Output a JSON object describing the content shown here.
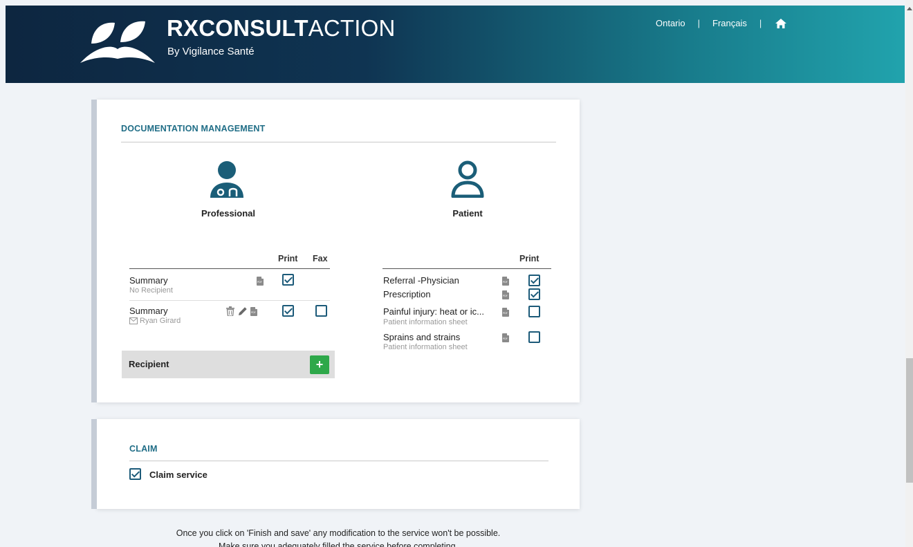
{
  "header": {
    "brand_bold": "RXCONSULT",
    "brand_light": "ACTION",
    "tagline": "By Vigilance Santé",
    "nav": {
      "province": "Ontario",
      "language": "Français"
    }
  },
  "documentation": {
    "title": "DOCUMENTATION MANAGEMENT",
    "professional": {
      "label": "Professional",
      "col_print": "Print",
      "col_fax": "Fax",
      "rows": [
        {
          "name": "Summary",
          "sub": "No Recipient",
          "print": true
        },
        {
          "name": "Summary",
          "sub": "Ryan Girard",
          "print": true,
          "fax": false
        }
      ],
      "recipient_label": "Recipient",
      "add_label": "+"
    },
    "patient": {
      "label": "Patient",
      "col_print": "Print",
      "rows": [
        {
          "name": "Referral -Physician",
          "sub": "",
          "print": true
        },
        {
          "name": "Prescription",
          "sub": "",
          "print": true
        },
        {
          "name": "Painful injury: heat or ic...",
          "sub": "Patient information sheet",
          "print": false
        },
        {
          "name": "Sprains and strains",
          "sub": "Patient information sheet",
          "print": false
        }
      ]
    }
  },
  "claim": {
    "title": "CLAIM",
    "service_label": "Claim service",
    "service_checked": true
  },
  "footer_note": {
    "line1": "Once you click on 'Finish and save' any modification to the service won't be possible.",
    "line2": "Make sure you adequately filled the service before completing."
  },
  "colors": {
    "accent": "#1f6d86",
    "add_button": "#2ea84a",
    "header_dark": "#0d2640",
    "header_light": "#21a3ad"
  }
}
